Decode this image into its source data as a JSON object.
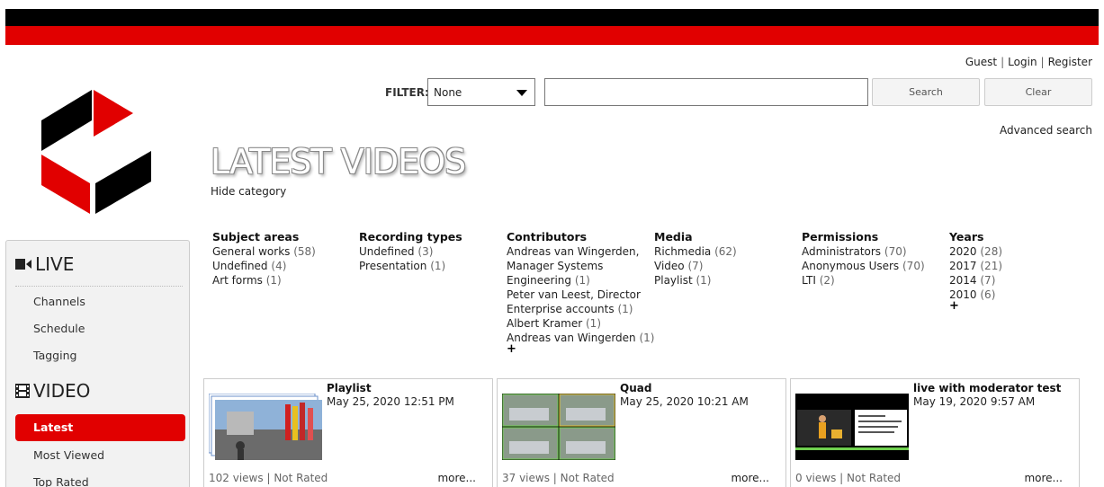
{
  "user_links": {
    "guest": "Guest",
    "login": "Login",
    "register": "Register",
    "separator": "|"
  },
  "filter": {
    "label": "FILTER:",
    "selected": "None",
    "query": ""
  },
  "buttons": {
    "search": "Search",
    "clear": "Clear"
  },
  "advanced_search": "Advanced search",
  "page_title": "LATEST VIDEOS",
  "hide_category": "Hide category",
  "categories": [
    {
      "title": "Subject areas",
      "items": [
        {
          "label": "General works",
          "count": "(58)"
        },
        {
          "label": "Undefined",
          "count": "(4)"
        },
        {
          "label": "Art forms",
          "count": "(1)"
        }
      ]
    },
    {
      "title": "Recording types",
      "items": [
        {
          "label": "Undefined",
          "count": "(3)"
        },
        {
          "label": "Presentation",
          "count": "(1)"
        }
      ]
    },
    {
      "title": "Contributors",
      "items": [
        {
          "label": "Andreas van Wingerden,",
          "count": ""
        },
        {
          "label": "Manager Systems",
          "count": ""
        },
        {
          "label": "Engineering",
          "count": "(1)"
        },
        {
          "label": "Peter van Leest, Director",
          "count": ""
        },
        {
          "label": "Enterprise accounts",
          "count": "(1)"
        },
        {
          "label": "Albert Kramer",
          "count": "(1)"
        },
        {
          "label": "Andreas van Wingerden",
          "count": "(1)"
        }
      ],
      "more": "+"
    },
    {
      "title": "Media",
      "items": [
        {
          "label": "Richmedia",
          "count": "(62)"
        },
        {
          "label": "Video",
          "count": "(7)"
        },
        {
          "label": "Playlist",
          "count": "(1)"
        }
      ]
    },
    {
      "title": "Permissions",
      "items": [
        {
          "label": "Administrators",
          "count": "(70)"
        },
        {
          "label": "Anonymous Users",
          "count": "(70)"
        },
        {
          "label": "LTI",
          "count": "(2)"
        }
      ]
    },
    {
      "title": "Years",
      "items": [
        {
          "label": "2020",
          "count": "(28)"
        },
        {
          "label": "2017",
          "count": "(21)"
        },
        {
          "label": "2014",
          "count": "(7)"
        },
        {
          "label": "2010",
          "count": "(6)"
        }
      ],
      "more": "+"
    }
  ],
  "sidebar": {
    "live_heading": "LIVE",
    "live_items": [
      "Channels",
      "Schedule",
      "Tagging"
    ],
    "video_heading": "VIDEO",
    "video_items": [
      "Latest",
      "Most Viewed",
      "Top Rated"
    ],
    "active_item": "Latest"
  },
  "videos": [
    {
      "title": "Playlist",
      "date": "May 25, 2020 12:51 PM",
      "views": "102 views",
      "rating": "Not Rated",
      "more": "more..."
    },
    {
      "title": "Quad",
      "date": "May 25, 2020 10:21 AM",
      "views": "37 views",
      "rating": "Not Rated",
      "more": "more..."
    },
    {
      "title": "live with moderator test",
      "date": "May 19, 2020 9:57 AM",
      "views": "0 views",
      "rating": "Not Rated",
      "more": "more..."
    }
  ],
  "colors": {
    "brand_red": "#e10000",
    "header_black": "#000000"
  },
  "icons": {
    "live": "video-camera-icon",
    "video": "film-icon",
    "dropdown": "caret-down-icon"
  }
}
